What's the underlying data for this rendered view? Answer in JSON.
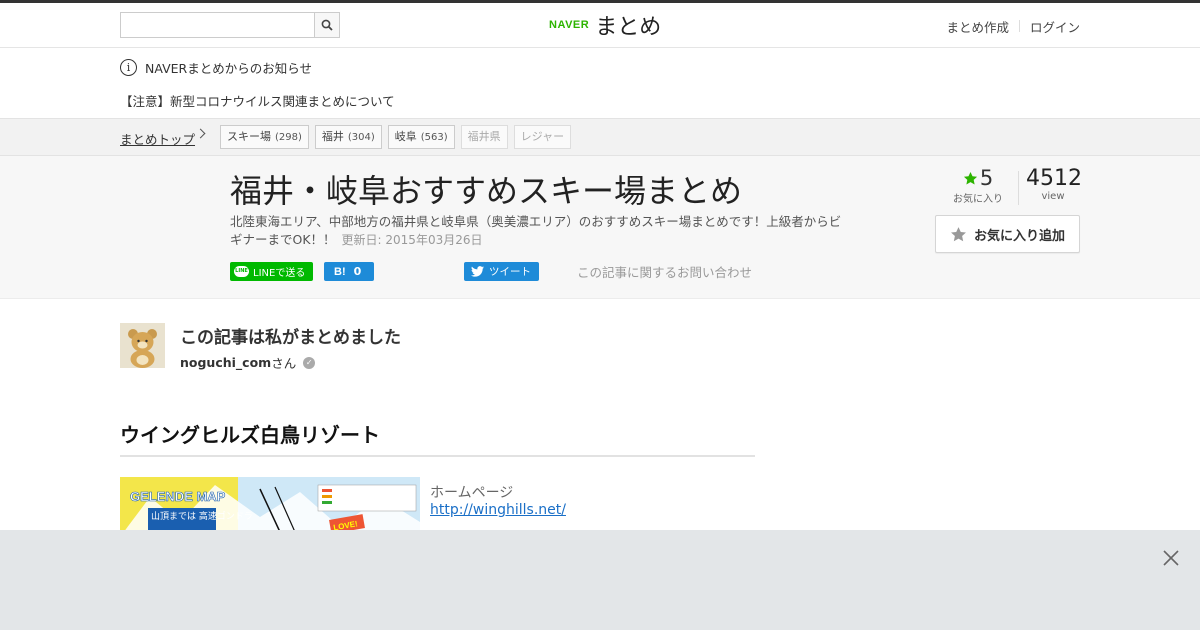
{
  "header": {
    "search_placeholder": "",
    "logo_naver": "NAVER",
    "logo_matome": "まとめ",
    "links": [
      "まとめ作成",
      "ログイン"
    ]
  },
  "notices": {
    "info": "NAVERまとめからのお知らせ",
    "covid": "【注意】新型コロナウイルス関連まとめについて"
  },
  "breadcrumb": {
    "top": "まとめトップ",
    "tags": [
      {
        "label": "スキー場",
        "count": "(298)"
      },
      {
        "label": "福井",
        "count": "(304)"
      },
      {
        "label": "岐阜",
        "count": "(563)"
      },
      {
        "label": "福井県",
        "count": ""
      },
      {
        "label": "レジャー",
        "count": ""
      }
    ]
  },
  "article": {
    "title": "福井・岐阜おすすめスキー場まとめ",
    "description": "北陸東海エリア、中部地方の福井県と岐阜県（奥美濃エリア）のおすすめスキー場まとめです！上級者からビギナーまでOK！！",
    "updated": "更新日: 2015年03月26日",
    "share": {
      "line": "LINEで送る",
      "line_icon_text": "LINE",
      "hatena_mark": "B!",
      "hatena_count": "0",
      "tweet": "ツイート"
    },
    "contact": "この記事に関するお問い合わせ",
    "fav_count": "5",
    "fav_label": "お気に入り",
    "views": "4512",
    "views_label": "view",
    "fav_button": "お気に入り追加"
  },
  "author": {
    "heading": "この記事は私がまとめました",
    "name": "noguchi_com",
    "suffix": "さん"
  },
  "section": {
    "title": "ウイングヒルズ白鳥リゾート",
    "homepage_label": "ホームページ",
    "homepage_url": "http://winghills.net/",
    "map_title": "GELENDE MAP",
    "map_sub": "山頂までは 高速ゴンドラ",
    "map_love": "LOVE!"
  },
  "colors": {
    "naver_green": "#2db400",
    "line_green": "#00b900",
    "share_blue": "#1e8bd8",
    "link_blue": "#1a6fc7"
  }
}
